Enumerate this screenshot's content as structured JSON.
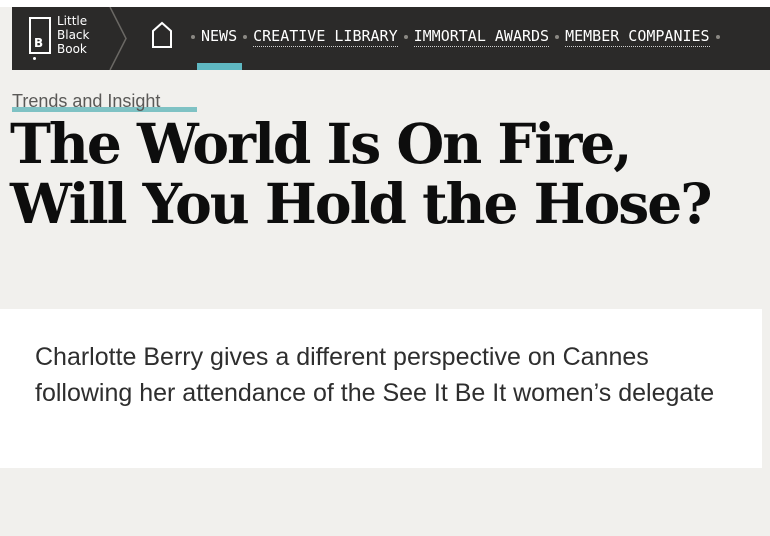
{
  "logo": {
    "mark_letter": "B",
    "lines": [
      "Little",
      "Black",
      "Book"
    ]
  },
  "nav": {
    "home_icon": "home-icon",
    "items": [
      {
        "label": "NEWS",
        "active": true
      },
      {
        "label": "CREATIVE LIBRARY",
        "active": false
      },
      {
        "label": "IMMORTAL AWARDS",
        "active": false
      },
      {
        "label": "MEMBER COMPANIES",
        "active": false
      }
    ],
    "active_color": "#5fb8c2"
  },
  "article": {
    "category": "Trends and Insight",
    "headline": "The World Is On Fire, Will You Hold the Hose?",
    "summary": "Charlotte Berry gives a different perspective on Cannes following her attendance of the See It Be It women’s delegate"
  },
  "colors": {
    "nav_background": "#2b2a29",
    "page_background": "#f1f0ed",
    "category_underline": "#7fc2c4"
  }
}
